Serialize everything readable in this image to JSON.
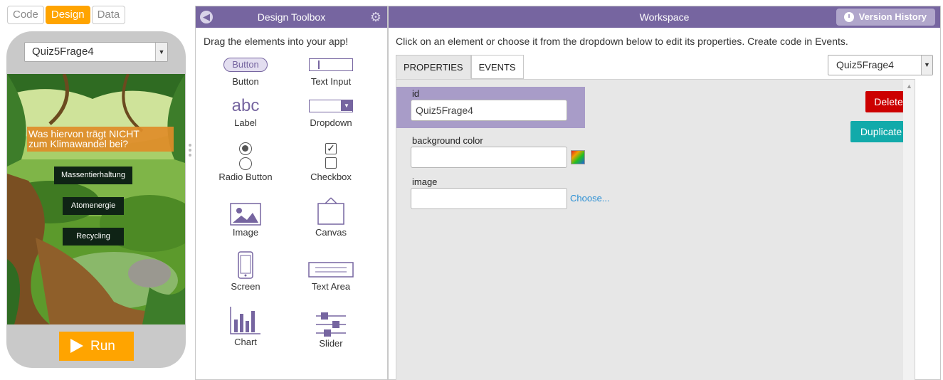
{
  "mode_tabs": [
    "Code",
    "Design",
    "Data"
  ],
  "screen_dropdown": {
    "value": "Quiz5Frage4"
  },
  "app": {
    "question": "Was hiervon trägt NICHT\nzum Klimawandel bei?",
    "answers": [
      "Massentierhaltung",
      "Atomenergie",
      "Recycling"
    ]
  },
  "run_label": "Run",
  "toolbox": {
    "title": "Design Toolbox",
    "hint": "Drag the elements into your app!",
    "items": [
      {
        "label": "Button",
        "icon": "button-icon",
        "chip": "Button"
      },
      {
        "label": "Text Input",
        "icon": "text-input-icon"
      },
      {
        "label": "Label",
        "icon": "label-icon",
        "glyph": "abc"
      },
      {
        "label": "Dropdown",
        "icon": "dropdown-icon"
      },
      {
        "label": "Radio Button",
        "icon": "radio-button-icon"
      },
      {
        "label": "Checkbox",
        "icon": "checkbox-icon"
      },
      {
        "label": "Image",
        "icon": "image-icon"
      },
      {
        "label": "Canvas",
        "icon": "canvas-icon"
      },
      {
        "label": "Screen",
        "icon": "screen-icon"
      },
      {
        "label": "Text Area",
        "icon": "text-area-icon"
      },
      {
        "label": "Chart",
        "icon": "chart-icon"
      },
      {
        "label": "Slider",
        "icon": "slider-icon"
      }
    ]
  },
  "workspace": {
    "title": "Workspace",
    "version_history": "Version History",
    "hint": "Click on an element or choose it from the dropdown below to edit its properties. Create code in Events.",
    "tabs": [
      "PROPERTIES",
      "EVENTS"
    ],
    "element_dropdown": "Quiz5Frage4",
    "properties": {
      "id_label": "id",
      "id_value": "Quiz5Frage4",
      "bg_label": "background color",
      "bg_value": "",
      "image_label": "image",
      "image_value": "",
      "choose_link": "Choose..."
    },
    "delete_label": "Delete",
    "duplicate_label": "Duplicate"
  },
  "colors": {
    "accent_orange": "#ffa400",
    "header_purple": "#7665a0",
    "delete_red": "#cc0000",
    "duplicate_teal": "#12aaaa"
  }
}
